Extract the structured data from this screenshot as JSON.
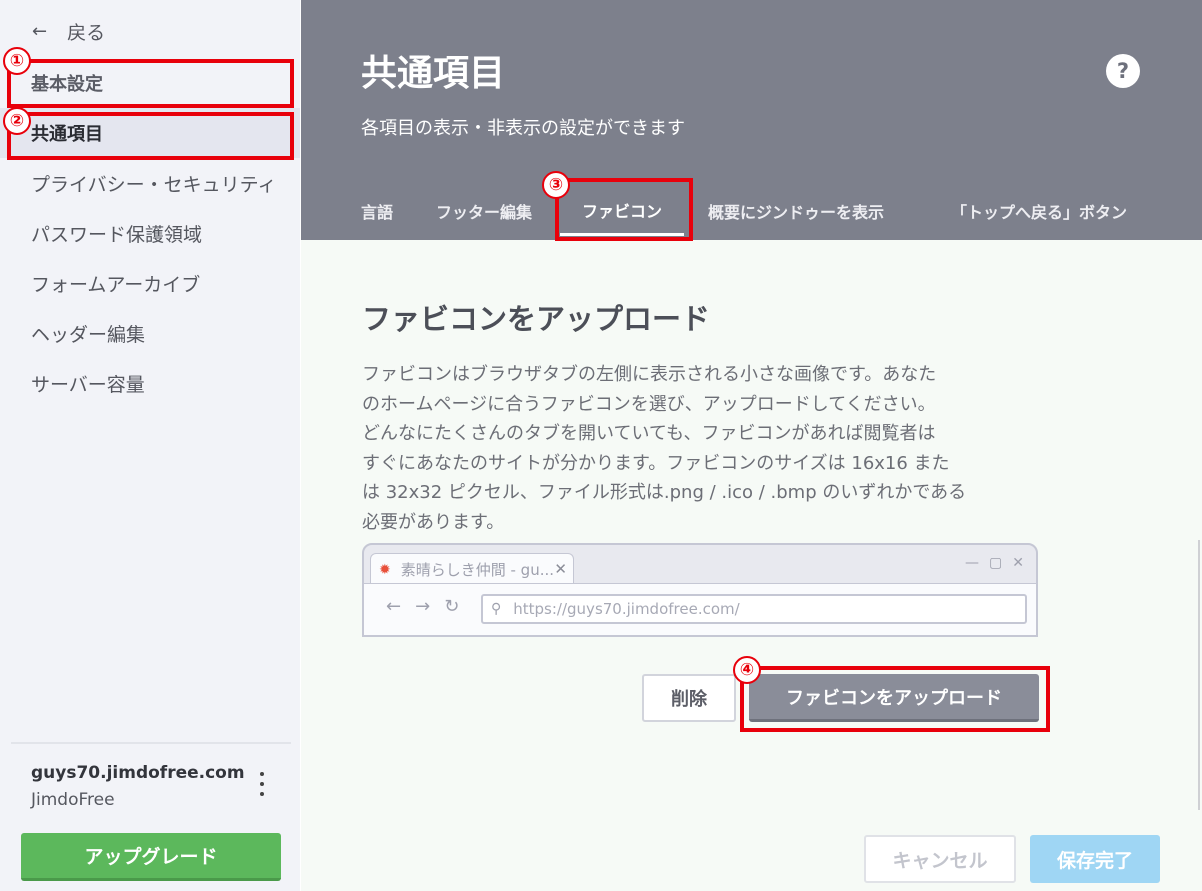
{
  "sidebar": {
    "back_label": "戻る",
    "back_arrow": "←",
    "items": [
      {
        "label": "基本設定"
      },
      {
        "label": "共通項目"
      },
      {
        "label": "プライバシー・セキュリティ"
      },
      {
        "label": "パスワード保護領域"
      },
      {
        "label": "フォームアーカイブ"
      },
      {
        "label": "ヘッダー編集"
      },
      {
        "label": "サーバー容量"
      }
    ],
    "site_name": "guys70.jimdofree.com",
    "site_plan": "JimdoFree",
    "upgrade_label": "アップグレード"
  },
  "header": {
    "title": "共通項目",
    "subtitle": "各項目の表示・非表示の設定ができます",
    "help": "?",
    "tabs": [
      {
        "label": "言語"
      },
      {
        "label": "フッター編集"
      },
      {
        "label": "ファビコン"
      },
      {
        "label": "概要にジンドゥーを表示"
      },
      {
        "label": "「トップへ戻る」ボタン"
      }
    ]
  },
  "main": {
    "section_title": "ファビコンをアップロード",
    "desc_lines": [
      "ファビコンはブラウザタブの左側に表示される小さな画像です。あなた",
      "のホームページに合うファビコンを選び、アップロードしてください。",
      "どんなにたくさんのタブを開いていても、ファビコンがあれば閲覧者は",
      "すぐにあなたのサイトが分かります。ファビコンのサイズは 16x16 また",
      "は 32x32 ピクセル、ファイル形式は.png / .ico / .bmp のいずれかである",
      "必要があります。"
    ],
    "browser": {
      "tab_title": "素晴らしき仲間 - gu...",
      "url": "https://guys70.jimdofree.com/"
    },
    "delete_label": "削除",
    "upload_label": "ファビコンをアップロード",
    "cancel_label": "キャンセル",
    "save_label": "保存完了"
  },
  "annotations": [
    "①",
    "②",
    "③",
    "④"
  ],
  "colors": {
    "header_bg": "#7d808c",
    "sidebar_bg": "#f2f3f8",
    "upgrade_green": "#5cb85c",
    "annotation_red": "#e8000b",
    "save_blue": "#9fd6f4"
  }
}
